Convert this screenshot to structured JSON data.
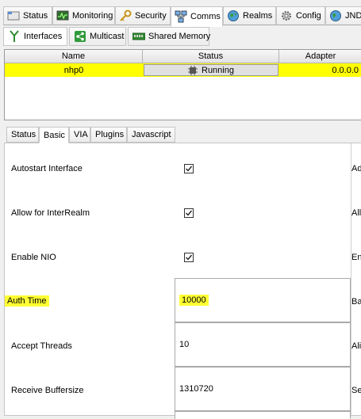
{
  "main_tabs": [
    {
      "label": "Status",
      "icon": "tabs-icon"
    },
    {
      "label": "Monitoring",
      "icon": "monitor-icon"
    },
    {
      "label": "Security",
      "icon": "key-icon"
    },
    {
      "label": "Comms",
      "icon": "network-icon",
      "active": true
    },
    {
      "label": "Realms",
      "icon": "globe-icon"
    },
    {
      "label": "Config",
      "icon": "gear-icon"
    },
    {
      "label": "JNDI",
      "icon": "globe-icon"
    }
  ],
  "sub_tabs": [
    {
      "label": "Interfaces",
      "icon": "fork-icon",
      "active": true
    },
    {
      "label": "Multicast",
      "icon": "share-icon"
    },
    {
      "label": "Shared Memory",
      "icon": "memory-icon"
    }
  ],
  "interfaces_table": {
    "columns": [
      "Name",
      "Status",
      "Adapter"
    ],
    "rows": [
      {
        "name": "nhp0",
        "status": "Running",
        "adapter": "0.0.0.0"
      }
    ],
    "row_highlight": "#ffff00"
  },
  "config_tabs": [
    {
      "label": "Status"
    },
    {
      "label": "Basic",
      "active": true
    },
    {
      "label": "VIA"
    },
    {
      "label": "Plugins"
    },
    {
      "label": "Javascript"
    }
  ],
  "basic": {
    "autostart": {
      "label": "Autostart Interface",
      "checked": true
    },
    "interrealm": {
      "label": "Allow for InterRealm",
      "checked": true
    },
    "nio": {
      "label": "Enable NIO",
      "checked": true
    },
    "auth_time": {
      "label": "Auth Time",
      "value": "10000"
    },
    "accept_threads": {
      "label": "Accept Threads",
      "value": "10"
    },
    "receive_buffer": {
      "label": "Receive Buffersize",
      "value": "1310720"
    },
    "right_labels": [
      "Adv",
      "Allo",
      "Ena",
      "Bac",
      "Alia",
      "Sen"
    ]
  },
  "colors": {
    "highlight": "#ffff33",
    "accent": "#ffff00"
  }
}
